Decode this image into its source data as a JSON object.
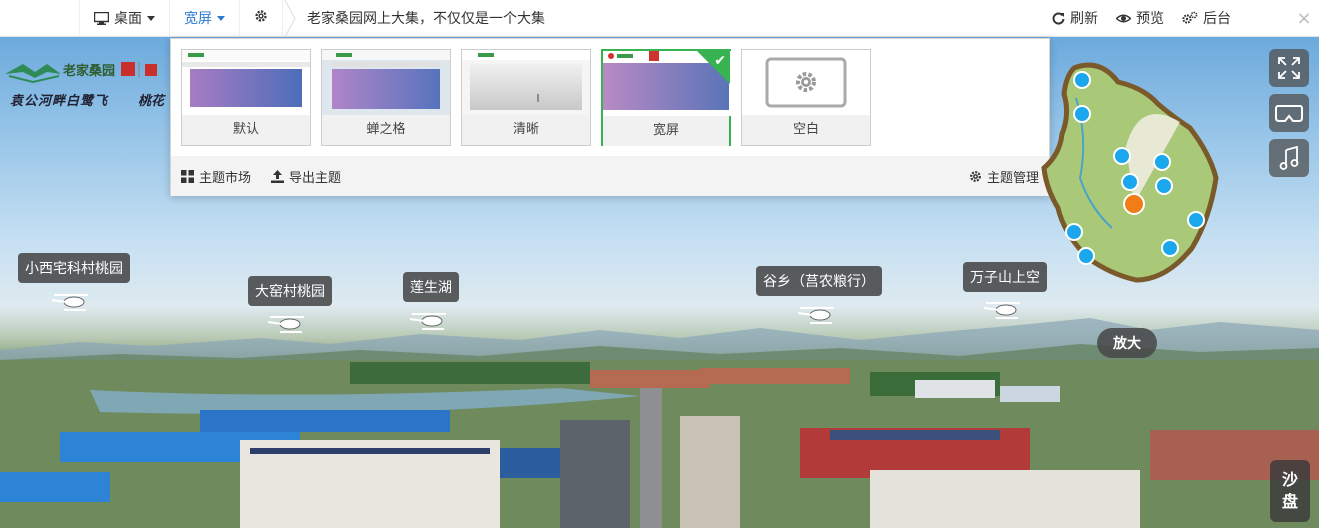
{
  "toolbar": {
    "desktop_label": "桌面",
    "widescreen_label": "宽屏",
    "page_title": "老家桑园网上大集，不仅仅是一个大集",
    "refresh_label": "刷新",
    "preview_label": "预览",
    "backend_label": "后台",
    "close_symbol": "×"
  },
  "themes": {
    "cards": [
      {
        "label": "默认",
        "style": "default"
      },
      {
        "label": "蝉之格",
        "style": "cicada"
      },
      {
        "label": "清晰",
        "style": "clear"
      },
      {
        "label": "宽屏",
        "style": "wide",
        "selected": true
      },
      {
        "label": "空白",
        "style": "blank"
      }
    ],
    "footer": {
      "market_label": "主题市场",
      "export_label": "导出主题",
      "manage_label": "主题管理"
    }
  },
  "logo": {
    "name": "老家桑园",
    "slogan": "袁公河畔白鹭飞",
    "slogan2": "桃花"
  },
  "hotspots": [
    {
      "label": "小西宅科村桃园"
    },
    {
      "label": "大窑村桃园"
    },
    {
      "label": "莲生湖"
    },
    {
      "label": "谷乡（莒农粮行）"
    },
    {
      "label": "万子山上空"
    }
  ],
  "right_tools": {
    "zoom_label": "放大",
    "sandpan_line1": "沙",
    "sandpan_line2": "盘"
  },
  "colors": {
    "accent": "#2b7bd1",
    "selected_green": "#38b351",
    "map_dot": "#1aa7ec",
    "map_current": "#f07d17"
  }
}
